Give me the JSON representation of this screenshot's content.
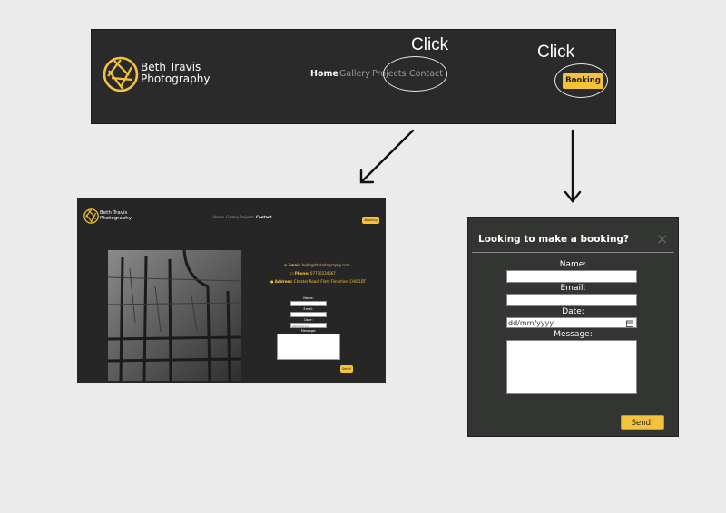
{
  "annotations": {
    "click_contact": "Click",
    "click_booking": "Click"
  },
  "brand": {
    "line1": "Beth Travis",
    "line2": "Photography",
    "accent": "#f5c33b"
  },
  "nav": {
    "home": "Home",
    "gallery": "Gallery",
    "projects": "Projects",
    "contact": "Contact",
    "booking": "Booking"
  },
  "contact_page": {
    "email_label": "Email:",
    "email_value": "hello@btphotography.com",
    "phone_label": "Phone:",
    "phone_value": "07770234567",
    "address_label": "Address:",
    "address_value": "Chester Road, Flint, Flintshire, CH6 5DT",
    "form": {
      "name_label": "Name:",
      "email_label": "Email:",
      "date_label": "Date:",
      "date_placeholder": "dd/mm/yyyy",
      "message_label": "Message:",
      "send": "Send!"
    }
  },
  "modal": {
    "title": "Looking to make a booking?",
    "close": "×",
    "name_label": "Name:",
    "email_label": "Email:",
    "date_label": "Date:",
    "date_placeholder": "dd/mm/yyyy",
    "message_label": "Message:",
    "send": "Send!"
  }
}
